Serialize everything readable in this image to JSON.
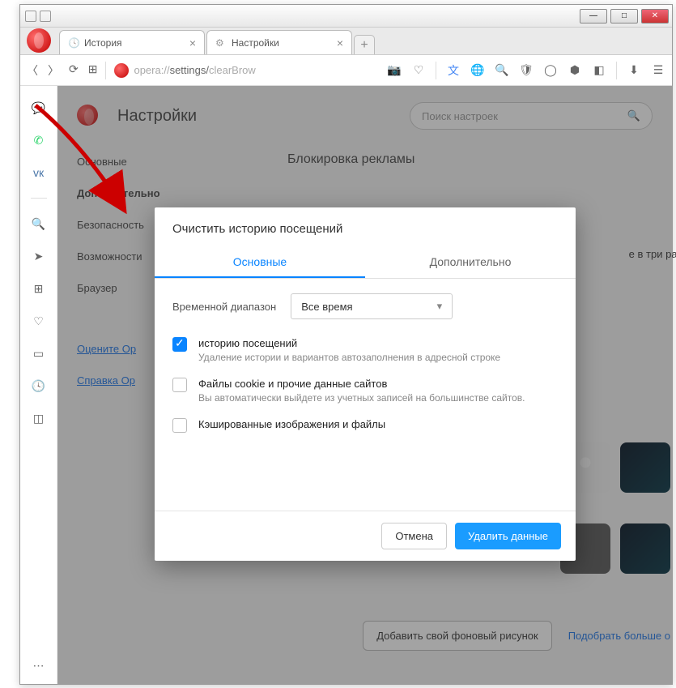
{
  "tabs": [
    {
      "label": "История"
    },
    {
      "label": "Настройки"
    }
  ],
  "address": {
    "prefix": "opera://",
    "path": "settings/",
    "tail": "clearBrow"
  },
  "page": {
    "title": "Настройки",
    "search_placeholder": "Поиск настроек",
    "section": "Блокировка рекламы",
    "side_text": "е в три раза бы"
  },
  "sidebar": {
    "items": [
      "Основные",
      "Дополнительно",
      "Безопасность",
      "Возможности",
      "Браузер"
    ],
    "links": [
      "Оцените Оp",
      "Справка Оp"
    ]
  },
  "dialog": {
    "title": "Очистить историю посещений",
    "tabs": {
      "basic": "Основные",
      "advanced": "Дополнительно"
    },
    "range_label": "Временной диапазон",
    "range_value": "Все время",
    "options": [
      {
        "checked": true,
        "title": "историю посещений",
        "desc": "Удаление истории и вариантов автозаполнения в адресной строке"
      },
      {
        "checked": false,
        "title": "Файлы cookie и прочие данные сайтов",
        "desc": "Вы автоматически выйдете из учетных записей на большинстве сайтов."
      },
      {
        "checked": false,
        "title": "Кэшированные изображения и файлы",
        "desc": ""
      }
    ],
    "cancel": "Отмена",
    "confirm": "Удалить данные"
  },
  "bottom": {
    "add_bg": "Добавить свой фоновый рисунок",
    "more": "Подобрать больше о"
  }
}
